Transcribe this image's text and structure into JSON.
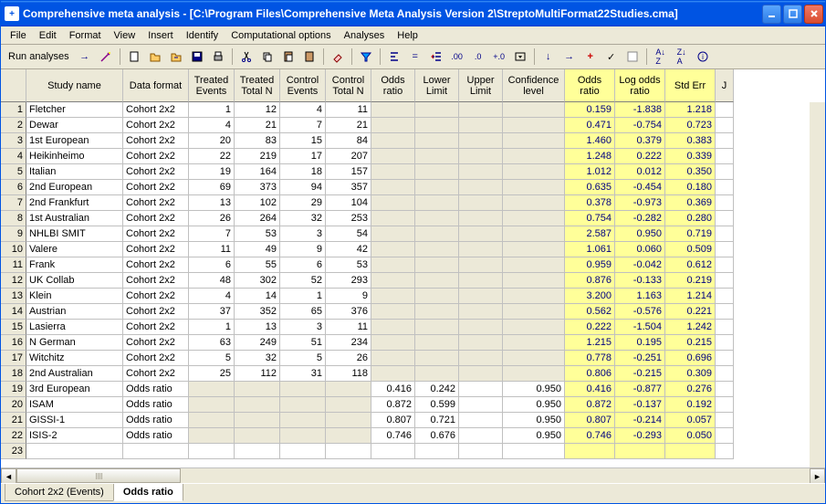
{
  "window": {
    "title": "Comprehensive meta analysis - [C:\\Program Files\\Comprehensive Meta Analysis Version 2\\StreptoMultiFormat22Studies.cma]"
  },
  "menu": {
    "items": [
      "File",
      "Edit",
      "Format",
      "View",
      "Insert",
      "Identify",
      "Computational options",
      "Analyses",
      "Help"
    ]
  },
  "toolbar": {
    "run_label": "Run analyses"
  },
  "headers": [
    "",
    "Study name",
    "Data format",
    "Treated Events",
    "Treated Total N",
    "Control Events",
    "Control Total N",
    "Odds ratio",
    "Lower Limit",
    "Upper Limit",
    "Confidence level",
    "Odds ratio",
    "Log odds ratio",
    "Std Err",
    "J"
  ],
  "rows": [
    {
      "n": 1,
      "study": "Fletcher",
      "fmt": "Cohort 2x2",
      "te": "1",
      "tn": "12",
      "ce": "4",
      "cn": "11",
      "or": "",
      "ll": "",
      "ul": "",
      "cl": "",
      "o": "0.159",
      "lo": "-1.838",
      "se": "1.218"
    },
    {
      "n": 2,
      "study": "Dewar",
      "fmt": "Cohort 2x2",
      "te": "4",
      "tn": "21",
      "ce": "7",
      "cn": "21",
      "or": "",
      "ll": "",
      "ul": "",
      "cl": "",
      "o": "0.471",
      "lo": "-0.754",
      "se": "0.723"
    },
    {
      "n": 3,
      "study": "1st European",
      "fmt": "Cohort 2x2",
      "te": "20",
      "tn": "83",
      "ce": "15",
      "cn": "84",
      "or": "",
      "ll": "",
      "ul": "",
      "cl": "",
      "o": "1.460",
      "lo": "0.379",
      "se": "0.383"
    },
    {
      "n": 4,
      "study": "Heikinheimo",
      "fmt": "Cohort 2x2",
      "te": "22",
      "tn": "219",
      "ce": "17",
      "cn": "207",
      "or": "",
      "ll": "",
      "ul": "",
      "cl": "",
      "o": "1.248",
      "lo": "0.222",
      "se": "0.339"
    },
    {
      "n": 5,
      "study": "Italian",
      "fmt": "Cohort 2x2",
      "te": "19",
      "tn": "164",
      "ce": "18",
      "cn": "157",
      "or": "",
      "ll": "",
      "ul": "",
      "cl": "",
      "o": "1.012",
      "lo": "0.012",
      "se": "0.350"
    },
    {
      "n": 6,
      "study": "2nd European",
      "fmt": "Cohort 2x2",
      "te": "69",
      "tn": "373",
      "ce": "94",
      "cn": "357",
      "or": "",
      "ll": "",
      "ul": "",
      "cl": "",
      "o": "0.635",
      "lo": "-0.454",
      "se": "0.180"
    },
    {
      "n": 7,
      "study": "2nd Frankfurt",
      "fmt": "Cohort 2x2",
      "te": "13",
      "tn": "102",
      "ce": "29",
      "cn": "104",
      "or": "",
      "ll": "",
      "ul": "",
      "cl": "",
      "o": "0.378",
      "lo": "-0.973",
      "se": "0.369"
    },
    {
      "n": 8,
      "study": "1st Australian",
      "fmt": "Cohort 2x2",
      "te": "26",
      "tn": "264",
      "ce": "32",
      "cn": "253",
      "or": "",
      "ll": "",
      "ul": "",
      "cl": "",
      "o": "0.754",
      "lo": "-0.282",
      "se": "0.280"
    },
    {
      "n": 9,
      "study": "NHLBI SMIT",
      "fmt": "Cohort 2x2",
      "te": "7",
      "tn": "53",
      "ce": "3",
      "cn": "54",
      "or": "",
      "ll": "",
      "ul": "",
      "cl": "",
      "o": "2.587",
      "lo": "0.950",
      "se": "0.719"
    },
    {
      "n": 10,
      "study": "Valere",
      "fmt": "Cohort 2x2",
      "te": "11",
      "tn": "49",
      "ce": "9",
      "cn": "42",
      "or": "",
      "ll": "",
      "ul": "",
      "cl": "",
      "o": "1.061",
      "lo": "0.060",
      "se": "0.509"
    },
    {
      "n": 11,
      "study": "Frank",
      "fmt": "Cohort 2x2",
      "te": "6",
      "tn": "55",
      "ce": "6",
      "cn": "53",
      "or": "",
      "ll": "",
      "ul": "",
      "cl": "",
      "o": "0.959",
      "lo": "-0.042",
      "se": "0.612"
    },
    {
      "n": 12,
      "study": "UK Collab",
      "fmt": "Cohort 2x2",
      "te": "48",
      "tn": "302",
      "ce": "52",
      "cn": "293",
      "or": "",
      "ll": "",
      "ul": "",
      "cl": "",
      "o": "0.876",
      "lo": "-0.133",
      "se": "0.219"
    },
    {
      "n": 13,
      "study": "Klein",
      "fmt": "Cohort 2x2",
      "te": "4",
      "tn": "14",
      "ce": "1",
      "cn": "9",
      "or": "",
      "ll": "",
      "ul": "",
      "cl": "",
      "o": "3.200",
      "lo": "1.163",
      "se": "1.214"
    },
    {
      "n": 14,
      "study": "Austrian",
      "fmt": "Cohort 2x2",
      "te": "37",
      "tn": "352",
      "ce": "65",
      "cn": "376",
      "or": "",
      "ll": "",
      "ul": "",
      "cl": "",
      "o": "0.562",
      "lo": "-0.576",
      "se": "0.221"
    },
    {
      "n": 15,
      "study": "Lasierra",
      "fmt": "Cohort 2x2",
      "te": "1",
      "tn": "13",
      "ce": "3",
      "cn": "11",
      "or": "",
      "ll": "",
      "ul": "",
      "cl": "",
      "o": "0.222",
      "lo": "-1.504",
      "se": "1.242"
    },
    {
      "n": 16,
      "study": "N German",
      "fmt": "Cohort 2x2",
      "te": "63",
      "tn": "249",
      "ce": "51",
      "cn": "234",
      "or": "",
      "ll": "",
      "ul": "",
      "cl": "",
      "o": "1.215",
      "lo": "0.195",
      "se": "0.215"
    },
    {
      "n": 17,
      "study": "Witchitz",
      "fmt": "Cohort 2x2",
      "te": "5",
      "tn": "32",
      "ce": "5",
      "cn": "26",
      "or": "",
      "ll": "",
      "ul": "",
      "cl": "",
      "o": "0.778",
      "lo": "-0.251",
      "se": "0.696"
    },
    {
      "n": 18,
      "study": "2nd Australian",
      "fmt": "Cohort 2x2",
      "te": "25",
      "tn": "112",
      "ce": "31",
      "cn": "118",
      "or": "",
      "ll": "",
      "ul": "",
      "cl": "",
      "o": "0.806",
      "lo": "-0.215",
      "se": "0.309"
    },
    {
      "n": 19,
      "study": "3rd European",
      "fmt": "Odds ratio",
      "te": "",
      "tn": "",
      "ce": "",
      "cn": "",
      "or": "0.416",
      "ll": "0.242",
      "ul": "",
      "cl": "0.950",
      "o": "0.416",
      "lo": "-0.877",
      "se": "0.276"
    },
    {
      "n": 20,
      "study": "ISAM",
      "fmt": "Odds ratio",
      "te": "",
      "tn": "",
      "ce": "",
      "cn": "",
      "or": "0.872",
      "ll": "0.599",
      "ul": "",
      "cl": "0.950",
      "o": "0.872",
      "lo": "-0.137",
      "se": "0.192"
    },
    {
      "n": 21,
      "study": "GISSI-1",
      "fmt": "Odds ratio",
      "te": "",
      "tn": "",
      "ce": "",
      "cn": "",
      "or": "0.807",
      "ll": "0.721",
      "ul": "",
      "cl": "0.950",
      "o": "0.807",
      "lo": "-0.214",
      "se": "0.057"
    },
    {
      "n": 22,
      "study": "ISIS-2",
      "fmt": "Odds ratio",
      "te": "",
      "tn": "",
      "ce": "",
      "cn": "",
      "or": "0.746",
      "ll": "0.676",
      "ul": "",
      "cl": "0.950",
      "o": "0.746",
      "lo": "-0.293",
      "se": "0.050"
    },
    {
      "n": 23,
      "study": "",
      "fmt": "",
      "te": "",
      "tn": "",
      "ce": "",
      "cn": "",
      "or": "",
      "ll": "",
      "ul": "",
      "cl": "",
      "o": "",
      "lo": "",
      "se": ""
    }
  ],
  "tabs": {
    "items": [
      "Cohort 2x2 (Events)",
      "Odds ratio"
    ],
    "active": 1
  }
}
